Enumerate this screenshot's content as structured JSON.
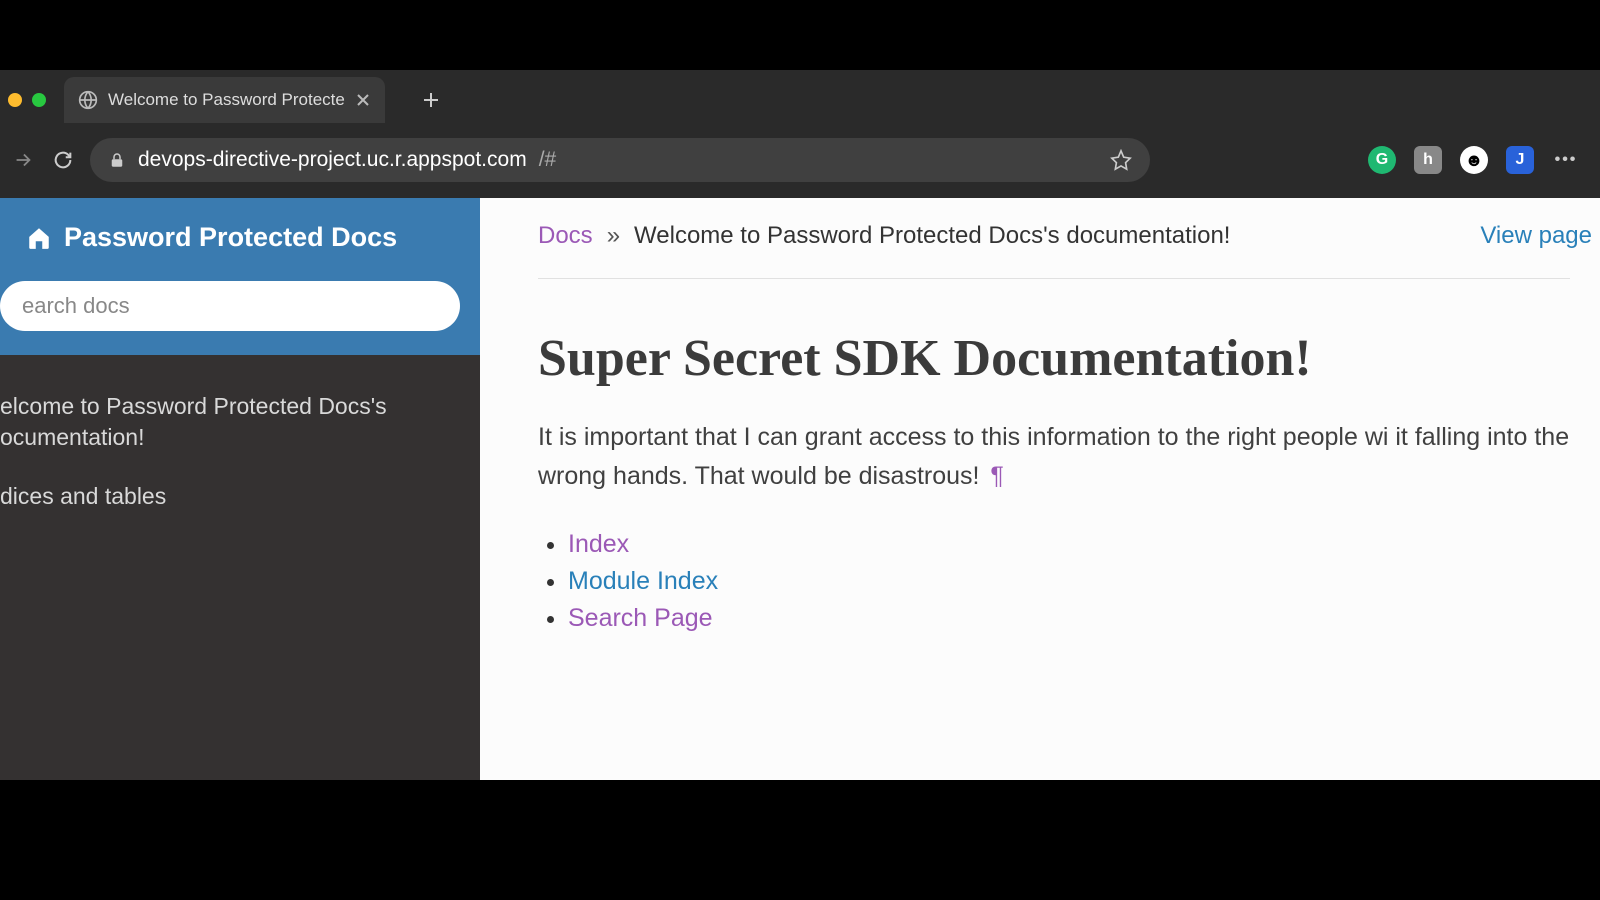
{
  "browser": {
    "tab_title": "Welcome to Password Protecte",
    "url_host": "devops-directive-project.uc.r.appspot.com",
    "url_path": "/#"
  },
  "sidebar": {
    "title": "Password Protected Docs",
    "search_placeholder": "earch docs",
    "nav": [
      "elcome to Password Protected Docs's ocumentation!",
      "dices and tables"
    ]
  },
  "breadcrumb": {
    "root": "Docs",
    "sep": "»",
    "current": "Welcome to Password Protected Docs's documentation!",
    "view_source": "View page"
  },
  "content": {
    "h1": "Super Secret SDK Documentation!",
    "paragraph": "It is important that I can grant access to this information to the right people wi it falling into the wrong hands. That would be disastrous!",
    "pilcrow": "¶",
    "links": {
      "index": "Index",
      "module_index": "Module Index",
      "search_page": "Search Page"
    }
  }
}
